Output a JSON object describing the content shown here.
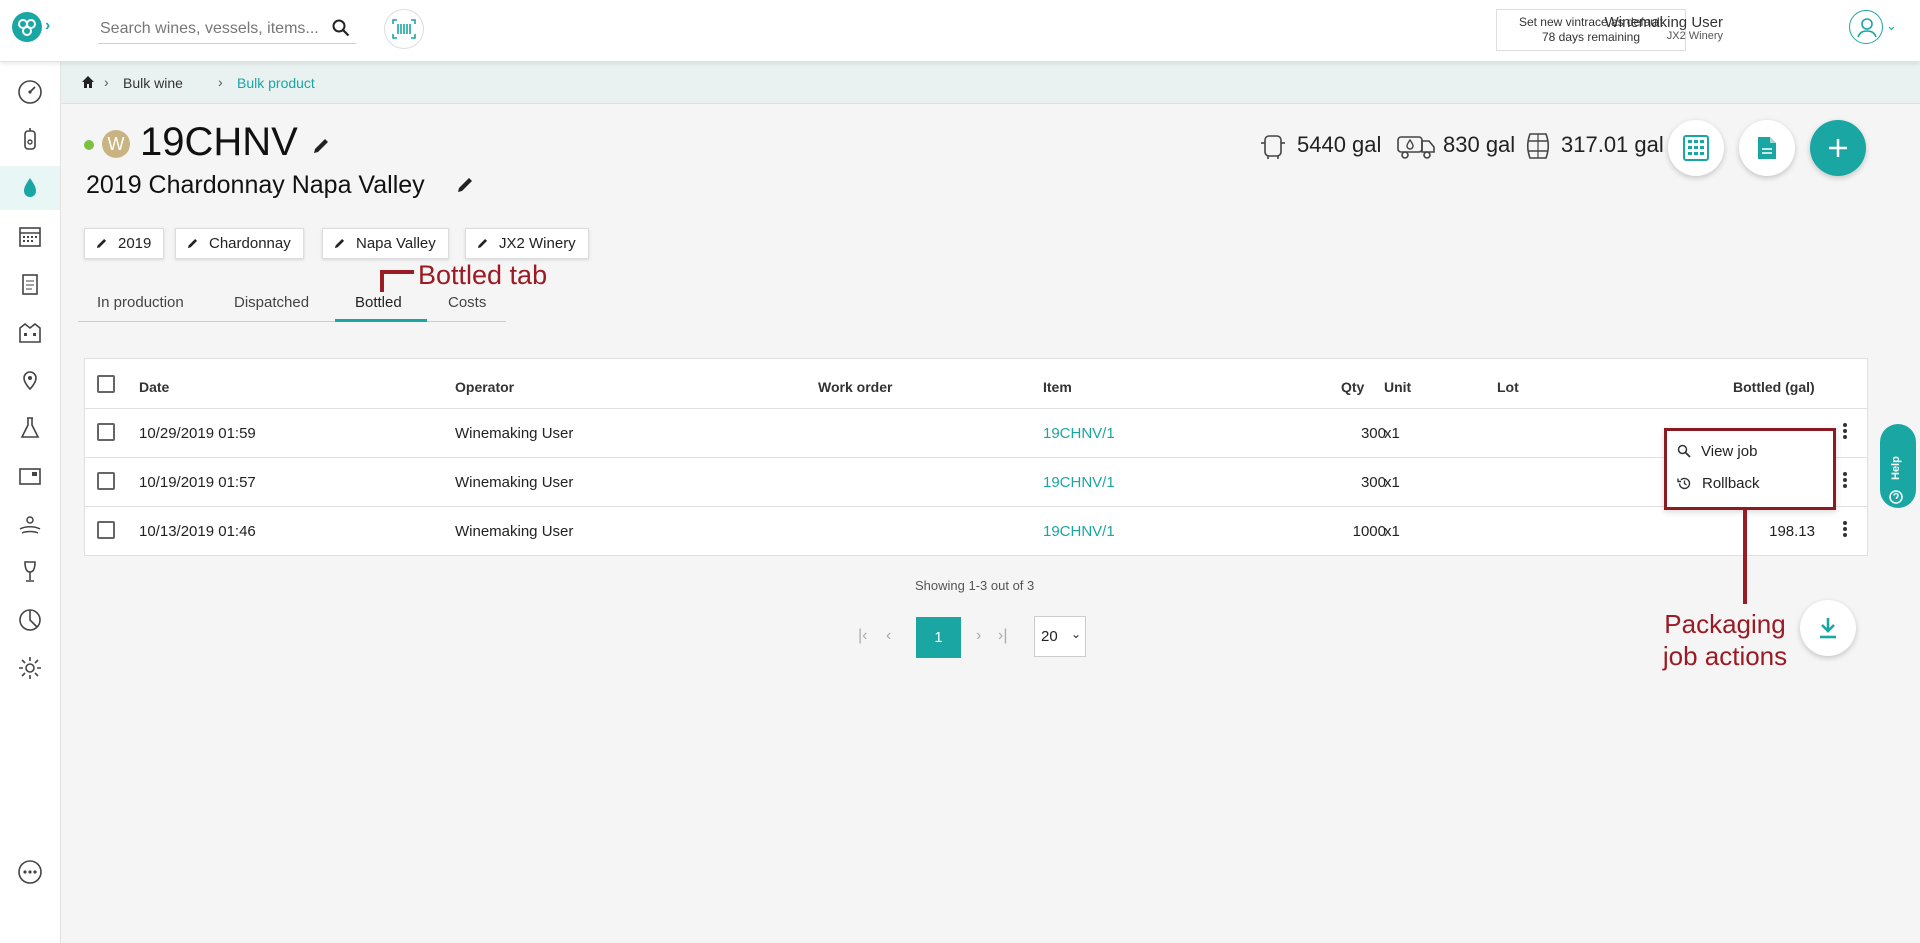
{
  "header": {
    "search_placeholder": "Search wines, vessels, items...",
    "vintrace_line1": "Set new vintrace as default",
    "vintrace_line2": "78 days remaining",
    "user_name": "Winemaking User",
    "user_winery": "JX2 Winery"
  },
  "breadcrumb": [
    "Bulk wine",
    "Bulk product"
  ],
  "product": {
    "badge": "W",
    "code": "19CHNV",
    "description": "2019 Chardonnay Napa Valley",
    "stats": [
      {
        "value": "5440 gal",
        "icon": "vessel-icon"
      },
      {
        "value": "830 gal",
        "icon": "truck-icon"
      },
      {
        "value": "317.01 gal",
        "icon": "barrel-icon"
      }
    ],
    "chips": [
      "2019",
      "Chardonnay",
      "Napa Valley",
      "JX2 Winery"
    ]
  },
  "tabs": [
    "In production",
    "Dispatched",
    "Bottled",
    "Costs"
  ],
  "active_tab": "Bottled",
  "annotations": {
    "bottled_tab": "Bottled tab",
    "packaging_line1": "Packaging",
    "packaging_line2": "job actions"
  },
  "table": {
    "columns": [
      "Date",
      "Operator",
      "Work order",
      "Item",
      "Qty",
      "Unit",
      "Lot",
      "Bottled (gal)"
    ],
    "rows": [
      {
        "date": "10/29/2019 01:59",
        "operator": "Winemaking User",
        "work_order": "",
        "item": "19CHNV/1",
        "qty": "300",
        "unit": "x1",
        "lot": "",
        "bottled": ""
      },
      {
        "date": "10/19/2019 01:57",
        "operator": "Winemaking User",
        "work_order": "",
        "item": "19CHNV/1",
        "qty": "300",
        "unit": "x1",
        "lot": "",
        "bottled": ""
      },
      {
        "date": "10/13/2019 01:46",
        "operator": "Winemaking User",
        "work_order": "",
        "item": "19CHNV/1",
        "qty": "1000",
        "unit": "x1",
        "lot": "",
        "bottled": "198.13"
      }
    ]
  },
  "row_menu": [
    "View job",
    "Rollback"
  ],
  "pagination": {
    "showing": "Showing 1-3 out of 3",
    "current_page": "1",
    "page_size": "20"
  },
  "help_label": "Help",
  "colors": {
    "accent": "#1aa6a3",
    "annotation": "#9b1b24"
  }
}
